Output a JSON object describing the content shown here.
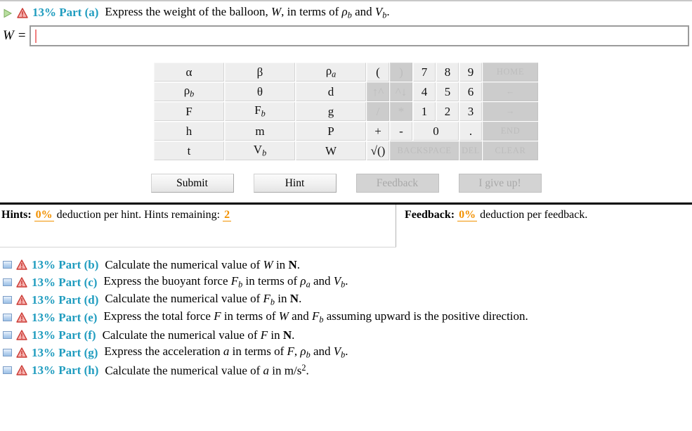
{
  "active_part": {
    "percent": "13%",
    "label": "13% Part (a)",
    "text_segments": [
      {
        "t": "Express the weight of the balloon, ",
        "style": "plain"
      },
      {
        "t": "W",
        "style": "italic"
      },
      {
        "t": ", in terms of ",
        "style": "plain"
      },
      {
        "t": "ρ",
        "style": "italic",
        "sub": "b"
      },
      {
        "t": " and ",
        "style": "plain"
      },
      {
        "t": "V",
        "style": "italic",
        "sub": "b"
      },
      {
        "t": ".",
        "style": "plain"
      }
    ],
    "plain_text": "Express the weight of the balloon, W, in terms of ρb and Vb.",
    "expand_icon": "play-triangle-icon",
    "status_icon": "warning-triangle-icon"
  },
  "answer": {
    "lhs": "W =",
    "value": "",
    "placeholder": ""
  },
  "keypad": {
    "rows": [
      [
        {
          "label": "α",
          "kind": "sym",
          "disabled": false,
          "name": "key-alpha"
        },
        {
          "label": "β",
          "kind": "sym",
          "disabled": false,
          "name": "key-beta"
        },
        {
          "label": "ρ",
          "sub": "a",
          "kind": "sym",
          "disabled": false,
          "name": "key-rho-a"
        },
        {
          "label": "(",
          "kind": "op",
          "disabled": false,
          "name": "key-open-paren"
        },
        {
          "label": ")",
          "kind": "op",
          "disabled": true,
          "name": "key-close-paren"
        },
        {
          "label": "7",
          "kind": "num",
          "disabled": false,
          "name": "key-7"
        },
        {
          "label": "8",
          "kind": "num",
          "disabled": false,
          "name": "key-8"
        },
        {
          "label": "9",
          "kind": "num",
          "disabled": false,
          "name": "key-9"
        },
        {
          "label": "HOME",
          "kind": "fn",
          "disabled": true,
          "name": "key-home"
        }
      ],
      [
        {
          "label": "ρ",
          "sub": "b",
          "kind": "sym",
          "disabled": false,
          "name": "key-rho-b"
        },
        {
          "label": "θ",
          "kind": "sym",
          "disabled": false,
          "name": "key-theta"
        },
        {
          "label": "d",
          "kind": "sym",
          "disabled": false,
          "name": "key-d"
        },
        {
          "label": "↑^",
          "kind": "op",
          "disabled": true,
          "name": "key-exponent-up"
        },
        {
          "label": "^↓",
          "kind": "op",
          "disabled": true,
          "name": "key-exponent-down"
        },
        {
          "label": "4",
          "kind": "num",
          "disabled": false,
          "name": "key-4"
        },
        {
          "label": "5",
          "kind": "num",
          "disabled": false,
          "name": "key-5"
        },
        {
          "label": "6",
          "kind": "num",
          "disabled": false,
          "name": "key-6"
        },
        {
          "label": "←",
          "kind": "fn",
          "disabled": true,
          "name": "key-arrow-left"
        }
      ],
      [
        {
          "label": "F",
          "kind": "sym",
          "disabled": false,
          "name": "key-F"
        },
        {
          "label": "F",
          "sub": "b",
          "kind": "sym",
          "disabled": false,
          "name": "key-F-b"
        },
        {
          "label": "g",
          "kind": "sym",
          "disabled": false,
          "name": "key-g"
        },
        {
          "label": "/",
          "kind": "op",
          "disabled": true,
          "name": "key-divide"
        },
        {
          "label": "*",
          "kind": "op",
          "disabled": true,
          "name": "key-multiply"
        },
        {
          "label": "1",
          "kind": "num",
          "disabled": false,
          "name": "key-1"
        },
        {
          "label": "2",
          "kind": "num",
          "disabled": false,
          "name": "key-2"
        },
        {
          "label": "3",
          "kind": "num",
          "disabled": false,
          "name": "key-3"
        },
        {
          "label": "→",
          "kind": "fn",
          "disabled": true,
          "name": "key-arrow-right"
        }
      ],
      [
        {
          "label": "h",
          "kind": "sym",
          "disabled": false,
          "name": "key-h"
        },
        {
          "label": "m",
          "kind": "sym",
          "disabled": false,
          "name": "key-m"
        },
        {
          "label": "P",
          "kind": "sym",
          "disabled": false,
          "name": "key-P"
        },
        {
          "label": "+",
          "kind": "op",
          "disabled": false,
          "name": "key-plus"
        },
        {
          "label": "-",
          "kind": "op",
          "disabled": false,
          "name": "key-minus"
        },
        {
          "label": "0",
          "kind": "num",
          "colspan": 2,
          "disabled": false,
          "name": "key-0"
        },
        {
          "label": ".",
          "kind": "num",
          "disabled": false,
          "name": "key-decimal"
        },
        {
          "label": "END",
          "kind": "fn",
          "disabled": true,
          "name": "key-end"
        }
      ],
      [
        {
          "label": "t",
          "kind": "sym",
          "disabled": false,
          "name": "key-t"
        },
        {
          "label": "V",
          "sub": "b",
          "kind": "sym",
          "disabled": false,
          "name": "key-V-b"
        },
        {
          "label": "W",
          "kind": "sym",
          "disabled": false,
          "name": "key-W"
        },
        {
          "label": "√()",
          "kind": "op",
          "disabled": false,
          "name": "key-sqrt"
        },
        {
          "label": "BACKSPACE",
          "kind": "small",
          "colspan": 3,
          "disabled": true,
          "name": "key-backspace"
        },
        {
          "label": "DEL",
          "kind": "small",
          "disabled": true,
          "name": "key-delete"
        },
        {
          "label": "CLEAR",
          "kind": "fn",
          "disabled": true,
          "name": "key-clear"
        }
      ]
    ]
  },
  "actions": [
    {
      "label": "Submit",
      "disabled": false,
      "name": "submit-button"
    },
    {
      "label": "Hint",
      "disabled": false,
      "name": "hint-button"
    },
    {
      "label": "Feedback",
      "disabled": true,
      "name": "feedback-button"
    },
    {
      "label": "I give up!",
      "disabled": true,
      "name": "give-up-button"
    }
  ],
  "hints": {
    "label": "Hints:",
    "deduction_pct": "0%",
    "deduction_text": "deduction per hint. Hints remaining:",
    "remaining": "2"
  },
  "feedback": {
    "label": "Feedback:",
    "deduction_pct": "0%",
    "deduction_text": "deduction per feedback."
  },
  "parts": [
    {
      "label": "13% Part (b)",
      "plain_text": "Calculate the numerical value of W in N.",
      "segments": [
        {
          "t": "Calculate the numerical value of ",
          "style": "plain"
        },
        {
          "t": "W",
          "style": "italic"
        },
        {
          "t": " in ",
          "style": "plain"
        },
        {
          "t": "N",
          "style": "bold"
        },
        {
          "t": ".",
          "style": "plain"
        }
      ]
    },
    {
      "label": "13% Part (c)",
      "plain_text": "Express the buoyant force Fb in terms of ρa and Vb.",
      "segments": [
        {
          "t": "Express the buoyant force ",
          "style": "plain"
        },
        {
          "t": "F",
          "style": "italic",
          "sub": "b"
        },
        {
          "t": " in terms of ",
          "style": "plain"
        },
        {
          "t": "ρ",
          "style": "italic",
          "sub": "a"
        },
        {
          "t": " and ",
          "style": "plain"
        },
        {
          "t": "V",
          "style": "italic",
          "sub": "b"
        },
        {
          "t": ".",
          "style": "plain"
        }
      ]
    },
    {
      "label": "13% Part (d)",
      "plain_text": "Calculate the numerical value of Fb in N.",
      "segments": [
        {
          "t": "Calculate the numerical value of ",
          "style": "plain"
        },
        {
          "t": "F",
          "style": "italic",
          "sub": "b"
        },
        {
          "t": " in ",
          "style": "plain"
        },
        {
          "t": "N",
          "style": "bold"
        },
        {
          "t": ".",
          "style": "plain"
        }
      ]
    },
    {
      "label": "13% Part (e)",
      "plain_text": "Express the total force F in terms of W and Fb assuming upward is the positive direction.",
      "segments": [
        {
          "t": "Express the total force ",
          "style": "plain"
        },
        {
          "t": "F",
          "style": "italic"
        },
        {
          "t": " in terms of ",
          "style": "plain"
        },
        {
          "t": "W",
          "style": "italic"
        },
        {
          "t": " and ",
          "style": "plain"
        },
        {
          "t": "F",
          "style": "italic",
          "sub": "b"
        },
        {
          "t": " assuming upward is the positive direction.",
          "style": "plain"
        }
      ]
    },
    {
      "label": "13% Part (f)",
      "plain_text": "Calculate the numerical value of F in N.",
      "segments": [
        {
          "t": "Calculate the numerical value of ",
          "style": "plain"
        },
        {
          "t": "F",
          "style": "italic"
        },
        {
          "t": " in ",
          "style": "plain"
        },
        {
          "t": "N",
          "style": "bold"
        },
        {
          "t": ".",
          "style": "plain"
        }
      ]
    },
    {
      "label": "13% Part (g)",
      "plain_text": "Express the acceleration a in terms of F, ρb and Vb.",
      "segments": [
        {
          "t": "Express the acceleration ",
          "style": "plain"
        },
        {
          "t": "a",
          "style": "italic"
        },
        {
          "t": " in terms of ",
          "style": "plain"
        },
        {
          "t": "F",
          "style": "italic"
        },
        {
          "t": ", ",
          "style": "plain"
        },
        {
          "t": "ρ",
          "style": "italic",
          "sub": "b"
        },
        {
          "t": " and ",
          "style": "plain"
        },
        {
          "t": "V",
          "style": "italic",
          "sub": "b"
        },
        {
          "t": ".",
          "style": "plain"
        }
      ]
    },
    {
      "label": "13% Part (h)",
      "plain_text": "Calculate the numerical value of a in m/s2.",
      "segments": [
        {
          "t": "Calculate the numerical value of ",
          "style": "plain"
        },
        {
          "t": "a",
          "style": "italic"
        },
        {
          "t": " in m/s",
          "style": "plain"
        },
        {
          "t": "2",
          "style": "sup"
        },
        {
          "t": ".",
          "style": "plain"
        }
      ]
    }
  ],
  "colors": {
    "part_label": "#1f9cbf",
    "accent_orange": "#f29100",
    "warning_red": "#d9534f",
    "caret": "#f08080"
  }
}
